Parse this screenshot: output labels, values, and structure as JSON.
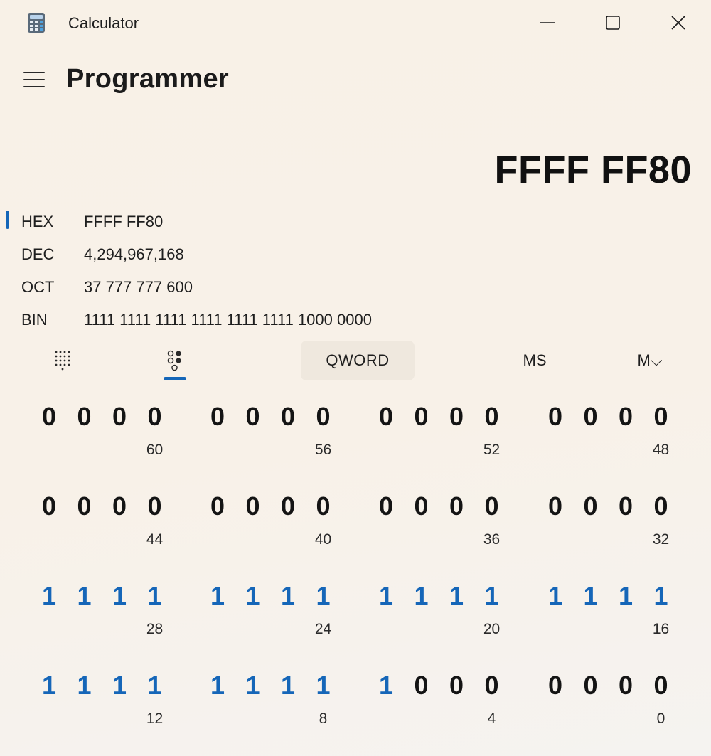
{
  "window": {
    "title": "Calculator",
    "icons": {
      "app": "calculator-icon",
      "minimize": "minimize-icon",
      "maximize": "maximize-icon",
      "close": "close-icon"
    }
  },
  "header": {
    "menu_icon": "hamburger-icon",
    "mode_title": "Programmer"
  },
  "display": {
    "result": "FFFF FF80"
  },
  "radix": [
    {
      "label": "HEX",
      "value": "FFFF FF80",
      "selected": true
    },
    {
      "label": "DEC",
      "value": "4,294,967,168",
      "selected": false
    },
    {
      "label": "OCT",
      "value": "37 777 777 600",
      "selected": false
    },
    {
      "label": "BIN",
      "value": "1111 1111 1111 1111 1111 1111 1000 0000",
      "selected": false
    }
  ],
  "toolbar": {
    "keypad_icon": "full-keypad-icon",
    "bitflip_icon": "bit-toggling-keypad-icon",
    "bitflip_selected": true,
    "word_size": "QWORD",
    "memory_store": "MS",
    "memory_list": "M⌵"
  },
  "colors": {
    "accent": "#1566b8",
    "background": "#f8f1e7",
    "set_bit": "#1566b8",
    "unset_bit": "#141414"
  },
  "bit_grid": {
    "rows": [
      {
        "groups": [
          {
            "bits": [
              "0",
              "0",
              "0",
              "0"
            ],
            "position": "60"
          },
          {
            "bits": [
              "0",
              "0",
              "0",
              "0"
            ],
            "position": "56"
          },
          {
            "bits": [
              "0",
              "0",
              "0",
              "0"
            ],
            "position": "52"
          },
          {
            "bits": [
              "0",
              "0",
              "0",
              "0"
            ],
            "position": "48"
          }
        ]
      },
      {
        "groups": [
          {
            "bits": [
              "0",
              "0",
              "0",
              "0"
            ],
            "position": "44"
          },
          {
            "bits": [
              "0",
              "0",
              "0",
              "0"
            ],
            "position": "40"
          },
          {
            "bits": [
              "0",
              "0",
              "0",
              "0"
            ],
            "position": "36"
          },
          {
            "bits": [
              "0",
              "0",
              "0",
              "0"
            ],
            "position": "32"
          }
        ]
      },
      {
        "groups": [
          {
            "bits": [
              "1",
              "1",
              "1",
              "1"
            ],
            "position": "28"
          },
          {
            "bits": [
              "1",
              "1",
              "1",
              "1"
            ],
            "position": "24"
          },
          {
            "bits": [
              "1",
              "1",
              "1",
              "1"
            ],
            "position": "20"
          },
          {
            "bits": [
              "1",
              "1",
              "1",
              "1"
            ],
            "position": "16"
          }
        ]
      },
      {
        "groups": [
          {
            "bits": [
              "1",
              "1",
              "1",
              "1"
            ],
            "position": "12"
          },
          {
            "bits": [
              "1",
              "1",
              "1",
              "1"
            ],
            "position": "8"
          },
          {
            "bits": [
              "1",
              "0",
              "0",
              "0"
            ],
            "position": "4"
          },
          {
            "bits": [
              "0",
              "0",
              "0",
              "0"
            ],
            "position": "0"
          }
        ]
      }
    ]
  }
}
